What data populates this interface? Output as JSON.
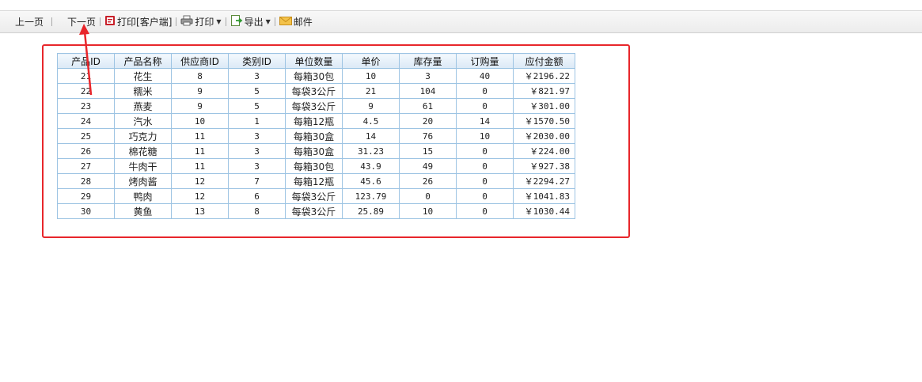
{
  "toolbar": {
    "prev_label": "上一页",
    "next_label": "下一页",
    "print_client_label": "打印[客户端]",
    "print_label": "打印",
    "export_label": "导出",
    "mail_label": "邮件"
  },
  "table": {
    "headers": [
      "产品ID",
      "产品名称",
      "供应商ID",
      "类别ID",
      "单位数量",
      "单价",
      "库存量",
      "订购量",
      "应付金额"
    ],
    "rows": [
      [
        "21",
        "花生",
        "8",
        "3",
        "每箱30包",
        "10",
        "3",
        "40",
        "￥2196.22"
      ],
      [
        "22",
        "糯米",
        "9",
        "5",
        "每袋3公斤",
        "21",
        "104",
        "0",
        "￥821.97"
      ],
      [
        "23",
        "燕麦",
        "9",
        "5",
        "每袋3公斤",
        "9",
        "61",
        "0",
        "￥301.00"
      ],
      [
        "24",
        "汽水",
        "10",
        "1",
        "每箱12瓶",
        "4.5",
        "20",
        "14",
        "￥1570.50"
      ],
      [
        "25",
        "巧克力",
        "11",
        "3",
        "每箱30盒",
        "14",
        "76",
        "10",
        "￥2030.00"
      ],
      [
        "26",
        "棉花糖",
        "11",
        "3",
        "每箱30盒",
        "31.23",
        "15",
        "0",
        "￥224.00"
      ],
      [
        "27",
        "牛肉干",
        "11",
        "3",
        "每箱30包",
        "43.9",
        "49",
        "0",
        "￥927.38"
      ],
      [
        "28",
        "烤肉酱",
        "12",
        "7",
        "每箱12瓶",
        "45.6",
        "26",
        "0",
        "￥2294.27"
      ],
      [
        "29",
        "鸭肉",
        "12",
        "6",
        "每袋3公斤",
        "123.79",
        "0",
        "0",
        "￥1041.83"
      ],
      [
        "30",
        "黄鱼",
        "13",
        "8",
        "每袋3公斤",
        "25.89",
        "10",
        "0",
        "￥1030.44"
      ]
    ]
  },
  "colors": {
    "highlight_frame": "#e8262b",
    "arrow": "#e8262b",
    "grid_border": "#9dc4e3"
  }
}
